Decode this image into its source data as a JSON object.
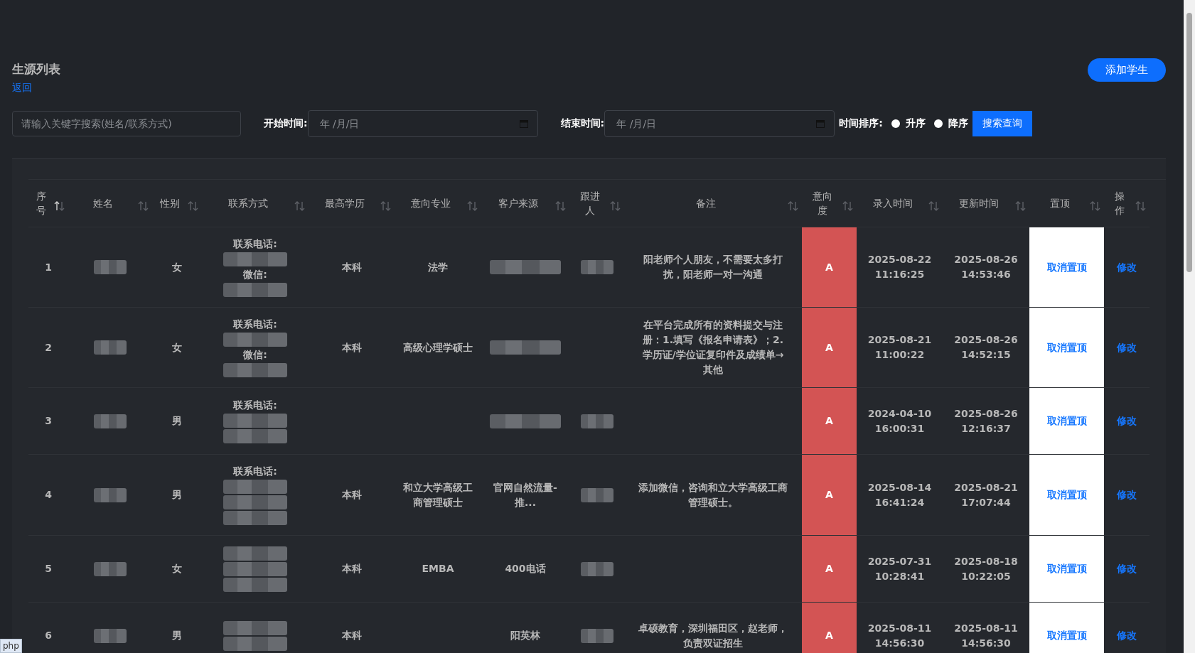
{
  "page": {
    "title": "生源列表",
    "back_link": "返回",
    "add_button": "添加学生"
  },
  "filters": {
    "search": {
      "placeholder": "请输入关键字搜索(姓名/联系方式)"
    },
    "start": {
      "label": "开始时间:",
      "placeholder": "年 /月/日"
    },
    "end": {
      "label": "结束时间:",
      "placeholder": "年 /月/日"
    },
    "sort_label": "时间排序:",
    "sort_options": [
      {
        "label": "升序",
        "selected": false
      },
      {
        "label": "降序",
        "selected": false
      }
    ],
    "search_button": "搜索查询"
  },
  "table": {
    "columns": [
      {
        "label": "序号",
        "sorted": true
      },
      {
        "label": "姓名",
        "sorted": false
      },
      {
        "label": "性别",
        "sorted": false
      },
      {
        "label": "联系方式",
        "sorted": false
      },
      {
        "label": "最高学历",
        "sorted": false
      },
      {
        "label": "意向专业",
        "sorted": false
      },
      {
        "label": "客户来源",
        "sorted": false
      },
      {
        "label": "跟进人",
        "sorted": false
      },
      {
        "label": "备注",
        "sorted": false
      },
      {
        "label": "意向度",
        "sorted": false
      },
      {
        "label": "录入时间",
        "sorted": false
      },
      {
        "label": "更新时间",
        "sorted": false
      },
      {
        "label": "置顶",
        "sorted": false
      },
      {
        "label": "操作",
        "sorted": false
      }
    ],
    "rows": [
      {
        "seq": "1",
        "name": {
          "kind": "redacted"
        },
        "gender": "女",
        "contact": [
          {
            "kind": "label",
            "text": "联系电话:"
          },
          {
            "kind": "redacted"
          },
          {
            "kind": "label",
            "text": "微信:"
          },
          {
            "kind": "redacted"
          }
        ],
        "education": "本科",
        "major": "法学",
        "source": {
          "kind": "redacted"
        },
        "follower": {
          "kind": "redacted"
        },
        "note": "阳老师个人朋友，不需要太多打扰，阳老师一对一沟通",
        "intent": "A",
        "created": {
          "date": "2025-08-22",
          "time": "11:16:25"
        },
        "updated": {
          "date": "2025-08-26",
          "time": "14:53:46"
        },
        "pinned": true,
        "pin": "取消置顶",
        "action": "修改"
      },
      {
        "seq": "2",
        "name": {
          "kind": "redacted"
        },
        "gender": "女",
        "contact": [
          {
            "kind": "label",
            "text": "联系电话:"
          },
          {
            "kind": "redacted"
          },
          {
            "kind": "label",
            "text": "微信:"
          },
          {
            "kind": "redacted"
          }
        ],
        "education": "本科",
        "major": "高级心理学硕士",
        "source": {
          "kind": "redacted"
        },
        "note": "在平台完成所有的资料提交与注册：1.填写《报名申请表》；2.学历证/学位证复印件及成绩单→其他",
        "intent": "A",
        "created": {
          "date": "2025-08-21",
          "time": "11:00:22"
        },
        "updated": {
          "date": "2025-08-26",
          "time": "14:52:15"
        },
        "pinned": true,
        "pin": "取消置顶",
        "action": "修改"
      },
      {
        "seq": "3",
        "name": {
          "kind": "redacted"
        },
        "gender": "男",
        "contact": [
          {
            "kind": "label",
            "text": "联系电话:"
          },
          {
            "kind": "redacted"
          },
          {
            "kind": "redacted"
          }
        ],
        "source": {
          "kind": "redacted"
        },
        "follower": {
          "kind": "redacted"
        },
        "intent": "A",
        "created": {
          "date": "2024-04-10",
          "time": "16:00:31"
        },
        "updated": {
          "date": "2025-08-26",
          "time": "12:16:37"
        },
        "pinned": true,
        "pin": "取消置顶",
        "action": "修改"
      },
      {
        "seq": "4",
        "name": {
          "kind": "redacted"
        },
        "gender": "男",
        "contact": [
          {
            "kind": "label",
            "text": "联系电话:"
          },
          {
            "kind": "redacted"
          },
          {
            "kind": "redacted"
          },
          {
            "kind": "redacted"
          }
        ],
        "education": "本科",
        "major": "和立大学高级工商管理硕士",
        "source": "官网自然流量-推...",
        "follower": {
          "kind": "redacted"
        },
        "note": "添加微信，咨询和立大学高级工商管理硕士。",
        "intent": "A",
        "created": {
          "date": "2025-08-14",
          "time": "16:41:24"
        },
        "updated": {
          "date": "2025-08-21",
          "time": "17:07:44"
        },
        "pinned": true,
        "pin": "取消置顶",
        "action": "修改"
      },
      {
        "seq": "5",
        "name": {
          "kind": "redacted"
        },
        "gender": "女",
        "contact": [
          {
            "kind": "redacted"
          },
          {
            "kind": "redacted"
          },
          {
            "kind": "redacted"
          }
        ],
        "education": "本科",
        "major": "EMBA",
        "source": "400电话",
        "follower": {
          "kind": "redacted"
        },
        "intent": "A",
        "created": {
          "date": "2025-07-31",
          "time": "10:28:41"
        },
        "updated": {
          "date": "2025-08-18",
          "time": "10:22:05"
        },
        "pinned": true,
        "pin": "取消置顶",
        "action": "修改"
      },
      {
        "seq": "6",
        "name": {
          "kind": "redacted"
        },
        "gender": "男",
        "contact": [
          {
            "kind": "redacted"
          },
          {
            "kind": "redacted"
          }
        ],
        "education": "本科",
        "source": "阳英林",
        "follower": {
          "kind": "redacted"
        },
        "note": "卓硕教育，深圳福田区，赵老师，负责双证招生",
        "intent": "A",
        "created": {
          "date": "2025-08-11",
          "time": "14:56:30"
        },
        "updated": {
          "date": "2025-08-11",
          "time": "14:56:30"
        },
        "pinned": true,
        "pin": "取消置顶",
        "action": "修改"
      }
    ]
  },
  "status_tooltip": "php"
}
